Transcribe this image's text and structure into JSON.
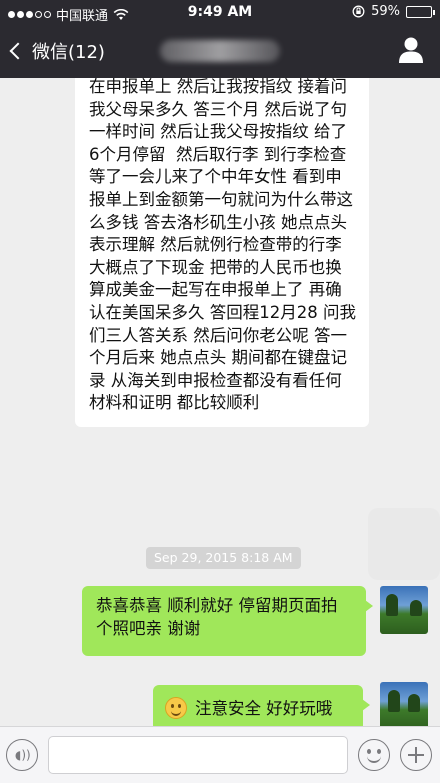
{
  "status_bar": {
    "carrier": "中国联通",
    "time": "9:49 AM",
    "battery": "59%",
    "battery_level": 0.59
  },
  "nav": {
    "back_label": "微信(12)"
  },
  "messages": {
    "incoming_text": "在申报单上 然后让我按指纹 接着问我父母呆多久 答三个月 然后说了句一样时间 然后让我父母按指纹 给了6个月停留  然后取行李 到行李检查 等了一会儿来了个中年女性 看到申报单上到金额第一句就问为什么带这么多钱 答去洛杉矶生小孩 她点点头表示理解 然后就例行检查带的行李 大概点了下现金 把带的人民币也换算成美金一起写在申报单上了 再确认在美国呆多久 答回程12月28 问我们三人答关系 然后问你老公呢 答一个月后来 她点点头 期间都在键盘记录 从海关到申报检查都没有看任何材料和证明 都比较顺利",
    "timestamp": "Sep 29, 2015 8:18 AM",
    "outgoing_1": "恭喜恭喜 顺利就好 停留期页面拍个照吧亲 谢谢",
    "outgoing_2": "注意安全 好好玩哦"
  },
  "icons": {
    "back": "chevron-left-icon",
    "profile": "person-icon",
    "voice": "voice-icon",
    "emoji": "smiley-icon",
    "plus": "plus-icon"
  },
  "colors": {
    "nav_bg": "#2b2a30",
    "chat_bg": "#eeeeee",
    "outgoing_bubble": "#a0e75a",
    "incoming_bubble": "#ffffff"
  }
}
